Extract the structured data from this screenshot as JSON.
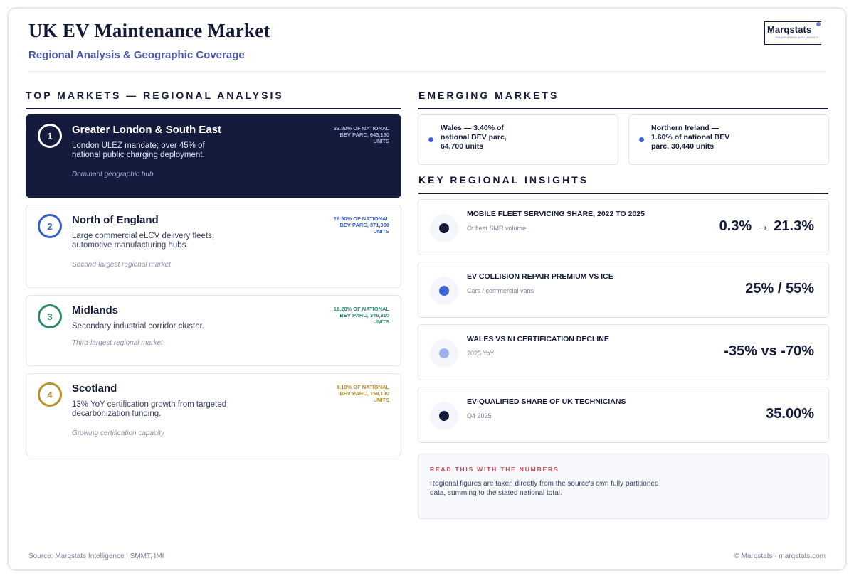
{
  "header": {
    "title": "UK EV Maintenance Market",
    "subtitle": "Regional Analysis & Geographic Coverage"
  },
  "logo": {
    "wordmark": "Marqstats",
    "tagline": "TRANSFORMING AUTO INSIGHTS"
  },
  "top_markets": {
    "title": "TOP MARKETS — REGIONAL ANALYSIS",
    "items": [
      {
        "rank": "1",
        "name": "Greater London & South East",
        "description": "London ULEZ mandate; over 45% of national public charging deployment.",
        "share": "33.80% OF NATIONAL BEV PARC, 643,150 UNITS",
        "note": "Dominant geographic hub",
        "color": "#ffffff"
      },
      {
        "rank": "2",
        "name": "North of England",
        "description": "Large commercial eLCV delivery fleets; automotive manufacturing hubs.",
        "share": "19.50% OF NATIONAL BEV PARC, 371,050 UNITS",
        "note": "Second-largest regional market",
        "color": "#3560c8"
      },
      {
        "rank": "3",
        "name": "Midlands",
        "description": "Secondary industrial corridor cluster.",
        "share": "18.20% OF NATIONAL BEV PARC, 346,310 UNITS",
        "note": "Third-largest regional market",
        "color": "#2e8b6a"
      },
      {
        "rank": "4",
        "name": "Scotland",
        "description": "13% YoY certification growth from targeted decarbonization funding.",
        "share": "8.10% OF NATIONAL BEV PARC, 154,130 UNITS",
        "note": "Growing certification capacity",
        "color": "#b8902a"
      }
    ]
  },
  "emerging_markets": {
    "title": "EMERGING MARKETS",
    "items": [
      {
        "text": "Wales — 3.40% of national BEV parc, 64,700 units"
      },
      {
        "text": "Northern Ireland — 1.60% of national BEV parc, 30,440 units"
      }
    ]
  },
  "insights": {
    "title": "KEY REGIONAL INSIGHTS",
    "items": [
      {
        "label": "MOBILE FLEET SERVICING SHARE, 2022 TO 2025",
        "sub": "Of fleet SMR volume",
        "value": "0.3% → 21.3%",
        "dot_color": "#141b3a"
      },
      {
        "label": "EV COLLISION REPAIR PREMIUM VS ICE",
        "sub": "Cars / commercial vans",
        "value": "25% / 55%",
        "dot_color": "#3d63d6"
      },
      {
        "label": "WALES VS NI CERTIFICATION DECLINE",
        "sub": "2025 YoY",
        "value": "-35% vs -70%",
        "dot_color": "#9fb1ea"
      },
      {
        "label": "EV-QUALIFIED SHARE OF UK TECHNICIANS",
        "sub": "Q4 2025",
        "value": "35.00%",
        "dot_color": "#141b3a"
      }
    ]
  },
  "note": {
    "title": "READ THIS WITH THE NUMBERS",
    "text": "Regional figures are taken directly from the source's own fully partitioned data, summing to the stated national total."
  },
  "footer": {
    "source": "Source: Marqstats Intelligence | SMMT, IMI",
    "copyright": "© Marqstats · marqstats.com"
  }
}
